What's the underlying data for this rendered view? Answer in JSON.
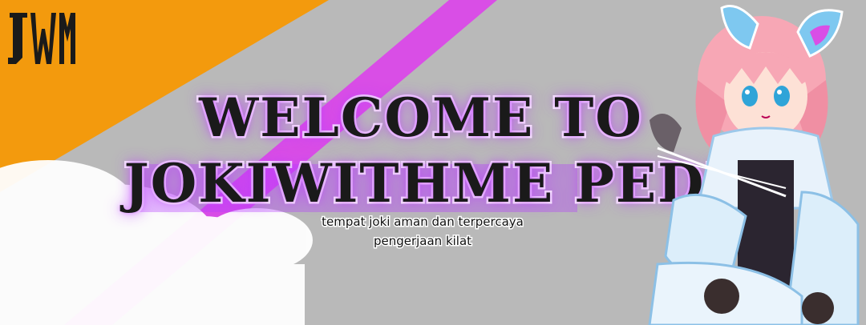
{
  "banner": {
    "logo_text": "JWM",
    "title_line1": "WELCOME TO",
    "title_line2": "JOKIWITHME PEDIA",
    "tagline_line1": "tempat joki aman dan terpercaya",
    "tagline_line2": "pengerjaan kilat"
  },
  "colors": {
    "orange": "#f39a0d",
    "magenta": "#d94ee6",
    "gray": "#b9b9b9",
    "glow": "#b43cff"
  }
}
